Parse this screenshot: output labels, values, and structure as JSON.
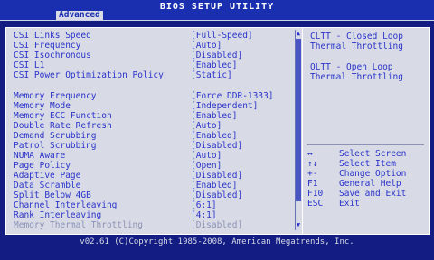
{
  "header": {
    "title": "BIOS SETUP UTILITY",
    "tab": "Advanced"
  },
  "settings": [
    {
      "label": "CSI Links Speed",
      "value": "[Full-Speed]"
    },
    {
      "label": "CSI Frequency",
      "value": "[Auto]"
    },
    {
      "label": "CSI Isochronous",
      "value": "[Disabled]"
    },
    {
      "label": "CSI L1",
      "value": "[Enabled]"
    },
    {
      "label": "CSI Power Optimization Policy",
      "value": "[Static]"
    },
    {
      "label": "Memory Frequency",
      "value": "[Force DDR-1333]"
    },
    {
      "label": "Memory Mode",
      "value": "[Independent]"
    },
    {
      "label": "Memory ECC Function",
      "value": "[Enabled]"
    },
    {
      "label": "Double Rate Refresh",
      "value": "[Auto]"
    },
    {
      "label": "Demand Scrubbing",
      "value": "[Enabled]"
    },
    {
      "label": "Patrol Scrubbing",
      "value": "[Disabled]"
    },
    {
      "label": "NUMA Aware",
      "value": "[Auto]"
    },
    {
      "label": "Page Policy",
      "value": "[Open]"
    },
    {
      "label": "Adaptive Page",
      "value": "[Disabled]"
    },
    {
      "label": "Data Scramble",
      "value": "[Enabled]"
    },
    {
      "label": "Split Below 4GB",
      "value": "[Disabled]"
    },
    {
      "label": "Channel Interleaving",
      "value": "[6:1]"
    },
    {
      "label": "Rank Interleaving",
      "value": "[4:1]"
    },
    {
      "label": "Memory Thermal Throttling",
      "value": "[Disabled]"
    }
  ],
  "help": {
    "line1": "CLTT - Closed Loop",
    "line2": "Thermal Throttling",
    "line3": "OLTT - Open Loop",
    "line4": "Thermal Throttling"
  },
  "keys": [
    {
      "key": "↔",
      "desc": "Select Screen"
    },
    {
      "key": "↑↓",
      "desc": "Select Item"
    },
    {
      "key": "+-",
      "desc": "Change Option"
    },
    {
      "key": "F1",
      "desc": "General Help"
    },
    {
      "key": "F10",
      "desc": "Save and Exit"
    },
    {
      "key": "ESC",
      "desc": "Exit"
    }
  ],
  "footer": {
    "text": "v02.61 (C)Copyright 1985-2008, American Megatrends, Inc."
  }
}
